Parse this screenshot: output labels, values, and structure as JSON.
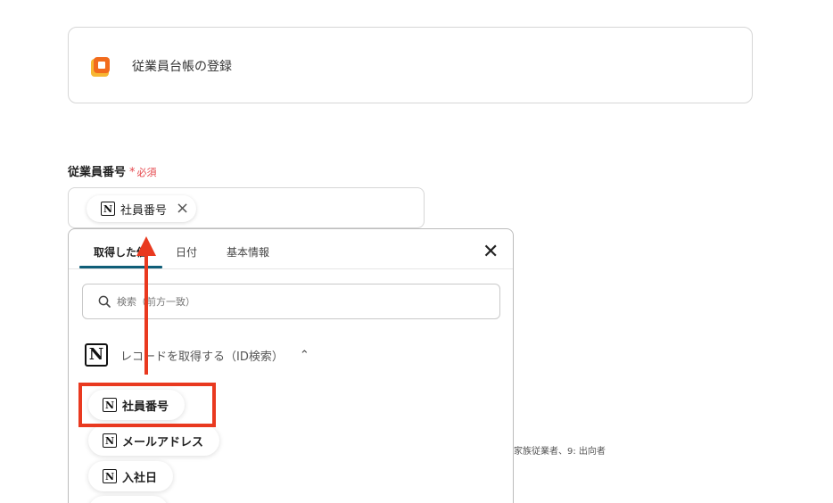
{
  "card": {
    "title": "従業員台帳の登録",
    "icon": "app-logo-icon"
  },
  "field": {
    "label": "従業員番号",
    "required_mark": "*",
    "required_text": "必須",
    "chip_label": "社員番号",
    "chip_icon": "notion-icon",
    "chip_remove_icon": "close-icon"
  },
  "panel": {
    "tabs": [
      {
        "label": "取得した値",
        "active": true
      },
      {
        "label": "日付",
        "active": false
      },
      {
        "label": "基本情報",
        "active": false
      }
    ],
    "close_icon": "close-icon",
    "search": {
      "placeholder": "検索（前方一致）",
      "icon": "search-icon"
    },
    "section": {
      "title": "レコードを取得する（ID検索）",
      "icon": "notion-icon",
      "chevron": "⌃"
    },
    "items": [
      {
        "label": "社員番号",
        "icon": "notion-icon"
      },
      {
        "label": "メールアドレス",
        "icon": "notion-icon"
      },
      {
        "label": "入社日",
        "icon": "notion-icon"
      },
      {
        "label": "",
        "icon": "notion-icon"
      }
    ]
  },
  "background_hint": "家族従業者、9: 出向者",
  "colors": {
    "accent": "#0f5e78",
    "annotation": "#e9391f",
    "required": "#e5484d",
    "logo_orange": "#f26b1d",
    "logo_yellow": "#f7b733"
  }
}
